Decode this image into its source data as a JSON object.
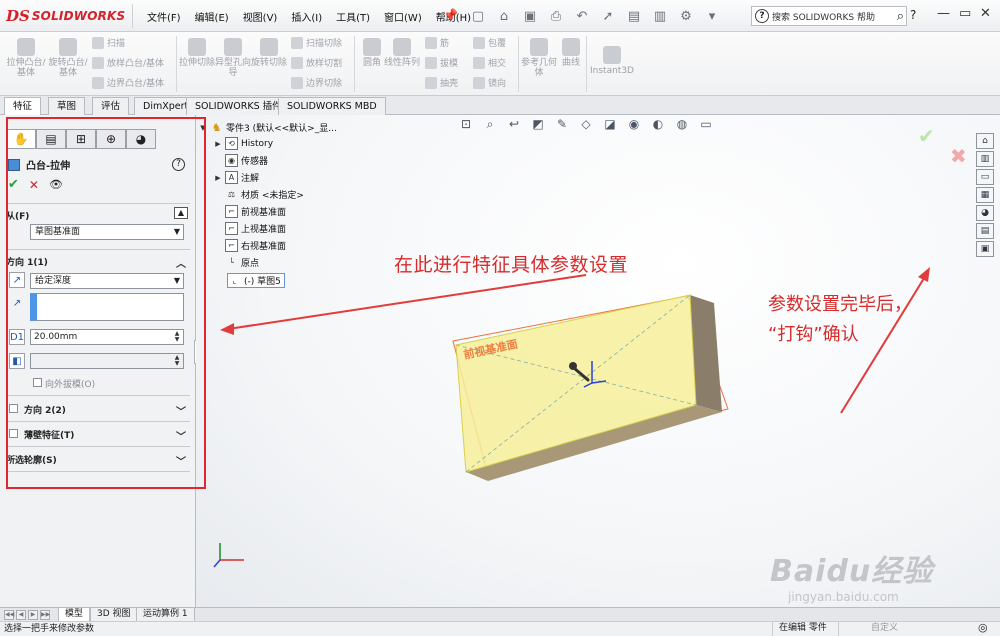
{
  "app": {
    "logo_ds": "DS",
    "logo_name": "SOLIDWORKS"
  },
  "menu": [
    "文件(F)",
    "编辑(E)",
    "视图(V)",
    "插入(I)",
    "工具(T)",
    "窗口(W)",
    "帮助(H)"
  ],
  "help_search": {
    "placeholder": "搜索 SOLIDWORKS 帮助",
    "help_label": "?"
  },
  "commands": {
    "extrude_boss": "拉伸凸台/基体",
    "revolve_boss": "旋转凸台/基体",
    "swept_boss": "扫描",
    "lofted_boss": "放样凸台/基体",
    "boundary_boss": "边界凸台/基体",
    "extrude_cut": "拉伸切除",
    "hole_wizard": "异型孔向导",
    "revolve_cut": "旋转切除",
    "swept_cut": "扫描切除",
    "lofted_cut": "放样切割",
    "boundary_cut": "边界切除",
    "fillet": "圆角",
    "linear_pattern": "线性阵列",
    "rib": "筋",
    "draft": "拔模",
    "shell": "抽壳",
    "wrap": "包覆",
    "intersect": "相交",
    "mirror": "镜向",
    "ref_geometry": "参考几何体",
    "curves": "曲线",
    "instant3d": "Instant3D"
  },
  "tabs": [
    "特征",
    "草图",
    "评估",
    "DimXpert",
    "SOLIDWORKS 插件",
    "SOLIDWORKS MBD"
  ],
  "property_manager": {
    "title": "凸台-拉伸",
    "from_label": "从(F)",
    "from_value": "草图基准面",
    "direction1_label": "方向 1(1)",
    "end_condition": "给定深度",
    "depth": "20.00mm",
    "draft_outward": "向外拔模(O)",
    "direction2_label": "方向 2(2)",
    "thin_feature_label": "薄壁特征(T)",
    "selected_contours_label": "所选轮廓(S)"
  },
  "feature_tree": {
    "root": "零件3  (默认<<默认>_显...",
    "items": [
      "History",
      "传感器",
      "注解",
      "材质 <未指定>",
      "前视基准面",
      "上视基准面",
      "右视基准面",
      "原点",
      "(-) 草图5"
    ]
  },
  "viewport": {
    "plane_label": "前视基准面"
  },
  "annotations": {
    "left_note": "在此进行特征具体参数设置",
    "right_note_line1": "参数设置完毕后，",
    "right_note_line2": "“打钩”确认"
  },
  "bottom_tabs": [
    "模型",
    "3D 视图",
    "运动算例 1"
  ],
  "status": {
    "left": "选择一把手来修改参数",
    "editing": "在编辑 零件",
    "custom": "自定义"
  },
  "watermark": {
    "line1": "Baidu经验",
    "line2": "jingyan.baidu.com"
  },
  "colors": {
    "accent_red": "#d62c2c",
    "ok_green": "#1fa23a",
    "brand_red": "#d3222a"
  }
}
